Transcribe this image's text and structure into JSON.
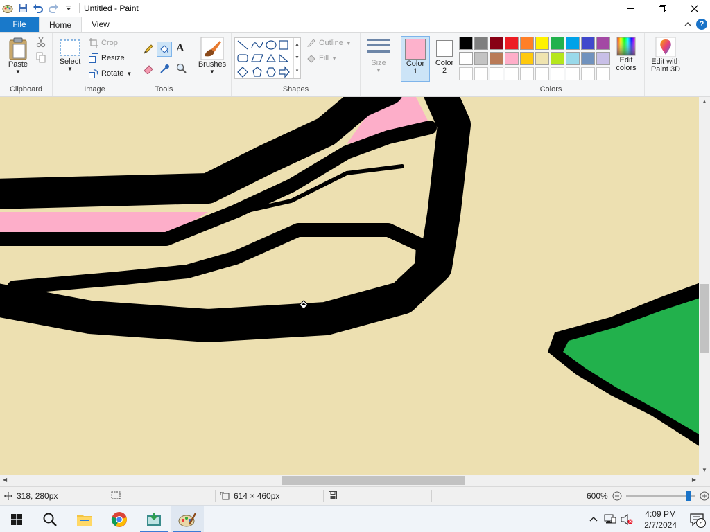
{
  "window": {
    "title": "Untitled - Paint"
  },
  "tabs": {
    "file": "File",
    "home": "Home",
    "view": "View"
  },
  "ribbon": {
    "clipboard": {
      "paste": "Paste",
      "label": "Clipboard"
    },
    "image": {
      "select": "Select",
      "crop": "Crop",
      "resize": "Resize",
      "rotate": "Rotate",
      "label": "Image"
    },
    "tools": {
      "label": "Tools"
    },
    "brushes": {
      "label": "Brushes"
    },
    "shapes": {
      "outline": "Outline",
      "fill": "Fill",
      "label": "Shapes"
    },
    "size": {
      "label": "Size"
    },
    "color1": {
      "label": "Color",
      "num": "1",
      "value": "#fdb2cc"
    },
    "color2": {
      "label": "Color",
      "num": "2",
      "value": "#ffffff"
    },
    "colors": {
      "label": "Colors",
      "edit_line1": "Edit",
      "edit_line2": "colors",
      "row1": [
        "#000000",
        "#7f7f7f",
        "#880015",
        "#ed1c24",
        "#ff7f27",
        "#fff200",
        "#22b14c",
        "#00a2e8",
        "#3f48cc",
        "#a349a4"
      ],
      "row2": [
        "#ffffff",
        "#c3c3c3",
        "#b97a57",
        "#ffaec9",
        "#ffc90e",
        "#efe4b0",
        "#b5e61d",
        "#99d9ea",
        "#7092be",
        "#c8bfe7"
      ],
      "row3": [
        "#ffffff",
        "#ffffff",
        "#ffffff",
        "#ffffff",
        "#ffffff",
        "#ffffff",
        "#ffffff",
        "#ffffff",
        "#ffffff",
        "#ffffff"
      ]
    },
    "paint3d": {
      "line1": "Edit with",
      "line2": "Paint 3D"
    }
  },
  "canvas": {
    "background": "#ede0b1",
    "pink": "#fdaec9",
    "green": "#22b14c"
  },
  "statusbar": {
    "cursor_pos": "318, 280px",
    "image_size": "614 × 460px",
    "zoom": "600%",
    "zoom_fraction": 0.93
  },
  "taskbar": {
    "time": "4:09 PM",
    "date": "2/7/2024",
    "notifications": "2"
  }
}
